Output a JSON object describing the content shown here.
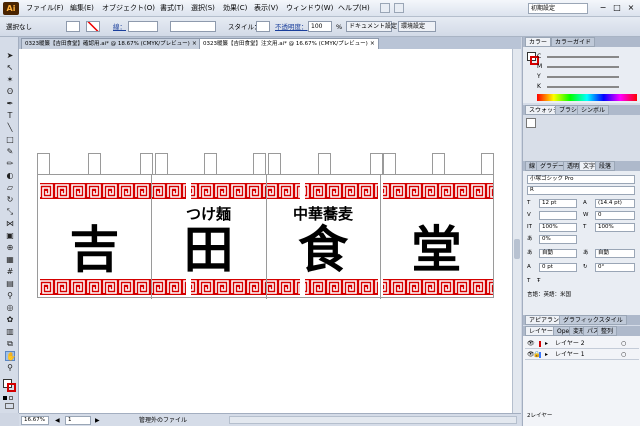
{
  "menu": {
    "app_logo": "Ai",
    "items": [
      "ファイル(F)",
      "編集(E)",
      "オブジェクト(O)",
      "書式(T)",
      "選択(S)",
      "効果(C)",
      "表示(V)",
      "ウィンドウ(W)",
      "ヘルプ(H)"
    ],
    "workspace": "初期設定",
    "win_min": "−",
    "win_max": "□",
    "win_close": "×"
  },
  "control": {
    "selection": "選択なし",
    "stroke_label": "線：",
    "style_label": "スタイル：",
    "opacity_label": "不透明度：",
    "opacity_value": "100",
    "percent": "%",
    "doc_setup": "ドキュメント設定",
    "prefs": "環境設定"
  },
  "tabs": [
    {
      "label": "0323暖簾【吉田食堂】確認用.ai* @ 18.67% (CMYK/プレビュー)",
      "close": "×",
      "active": false
    },
    {
      "label": "0323暖簾【吉田食堂】注文用.ai* @ 16.67% (CMYK/プレビュー)",
      "close": "×",
      "active": true
    }
  ],
  "artwork": {
    "subtitles": [
      "つけ麺",
      "中華蕎麦"
    ],
    "big_chars": [
      "吉",
      "田",
      "食",
      "堂"
    ],
    "accent_color": "#d40000"
  },
  "status": {
    "zoom": "16.67%",
    "page": "1",
    "info": "管理外のファイル"
  },
  "color_panel": {
    "tabs": [
      "カラー",
      "カラーガイド"
    ],
    "channels": [
      "C",
      "M",
      "Y",
      "K"
    ]
  },
  "swatch_panel": {
    "tabs": [
      "スウォッチ",
      "ブラシ",
      "シンボル"
    ]
  },
  "character_panel": {
    "tabs": [
      "線",
      "グラデー",
      "透明",
      "文字",
      "段落"
    ],
    "font": "小塚ゴシック Pro",
    "style": "R",
    "size": "12 pt",
    "leading": "(14.4 pt)",
    "tracking": "0",
    "scale_v": "100%",
    "scale_h": "100%",
    "tsume": "0%",
    "auto1": "自動",
    "auto2": "自動",
    "baseline": "0 pt",
    "rotate": "0°",
    "language": "言語：英語：米国"
  },
  "appearance_panel": {
    "tabs": [
      "アピアランス",
      "グラフィックスタイル"
    ]
  },
  "layers_panel": {
    "tabs": [
      "レイヤー",
      "Open",
      "変形",
      "パス",
      "整列"
    ],
    "layers": [
      "レイヤー 2",
      "レイヤー 1"
    ],
    "count": "2レイヤー"
  }
}
